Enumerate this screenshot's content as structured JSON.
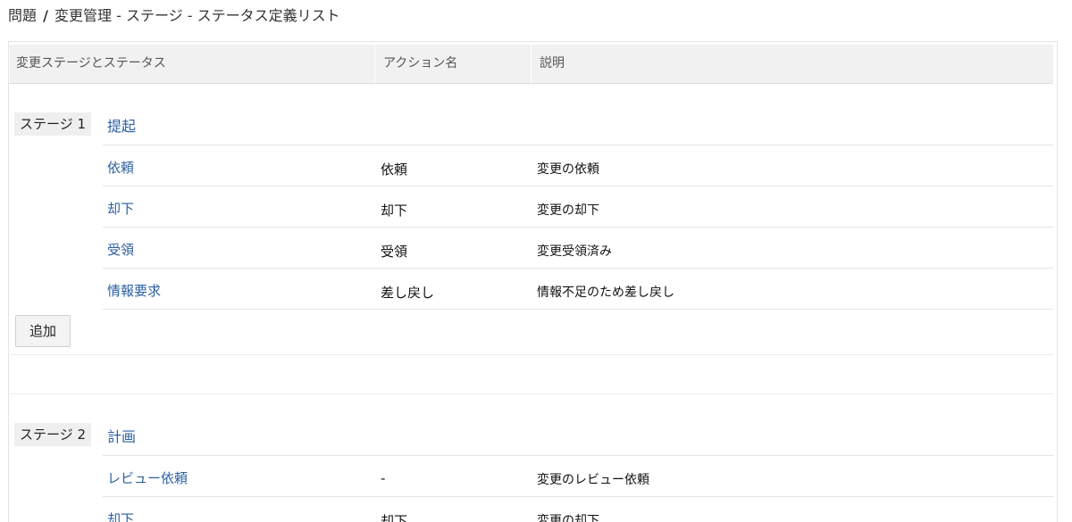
{
  "breadcrumb": {
    "root": "問題",
    "separator": "/",
    "current": "変更管理 - ステージ - ステータス定義リスト"
  },
  "table": {
    "headers": [
      "変更ステージとステータス",
      "アクション名",
      "説明"
    ]
  },
  "stages": [
    {
      "label": "ステージ 1",
      "name": "提起",
      "statuses": [
        {
          "status": "依頼",
          "action": "依頼",
          "description": "変更の依頼"
        },
        {
          "status": "却下",
          "action": "却下",
          "description": "変更の却下"
        },
        {
          "status": "受領",
          "action": "受領",
          "description": "変更受領済み"
        },
        {
          "status": "情報要求",
          "action": "差し戻し",
          "description": "情報不足のため差し戻し"
        }
      ],
      "add_label": "追加"
    },
    {
      "label": "ステージ 2",
      "name": "計画",
      "statuses": [
        {
          "status": "レビュー依頼",
          "action": "-",
          "description": "変更のレビュー依頼"
        },
        {
          "status": "却下",
          "action": "却下",
          "description": "変更の却下"
        }
      ]
    }
  ],
  "colors": {
    "link": "#2c5fa0",
    "header_bg": "#f1f1f1",
    "stage_label_bg": "#efefef"
  }
}
